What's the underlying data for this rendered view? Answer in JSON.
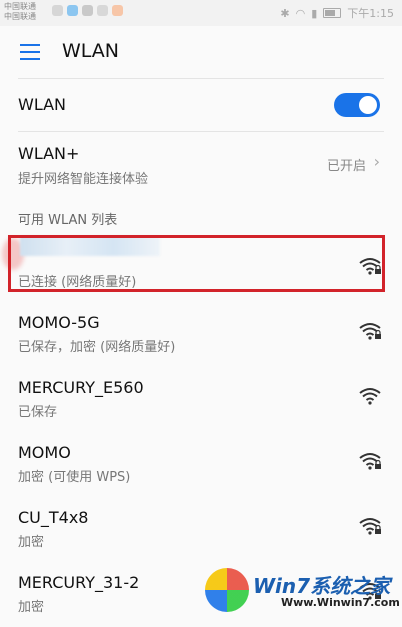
{
  "status_bar": {
    "carrier_1": "中国联通",
    "carrier_2": "中国联通",
    "time": "下午1:15"
  },
  "header": {
    "title": "WLAN"
  },
  "wlan_toggle": {
    "label": "WLAN",
    "state": "on"
  },
  "wlan_plus": {
    "label": "WLAN+",
    "subtitle": "提升网络智能连接体验",
    "status": "已开启"
  },
  "section_header": "可用 WLAN 列表",
  "networks": [
    {
      "name": "",
      "status": "已连接 (网络质量好)",
      "secured": true
    },
    {
      "name": "MOMO-5G",
      "status": "已保存，加密 (网络质量好)",
      "secured": true
    },
    {
      "name": "MERCURY_E560",
      "status": "已保存",
      "secured": false
    },
    {
      "name": "MOMO",
      "status": "加密 (可使用 WPS)",
      "secured": true
    },
    {
      "name": "CU_T4x8",
      "status": "加密",
      "secured": true
    },
    {
      "name": "MERCURY_31-2",
      "status": "加密",
      "secured": true
    }
  ],
  "watermark": {
    "brand": "Win7系统之家",
    "url": "Www.Winwin7.com"
  },
  "colors": {
    "accent": "#1a73e8",
    "highlight": "#d2232a",
    "watermark": "#1b5fb0"
  }
}
